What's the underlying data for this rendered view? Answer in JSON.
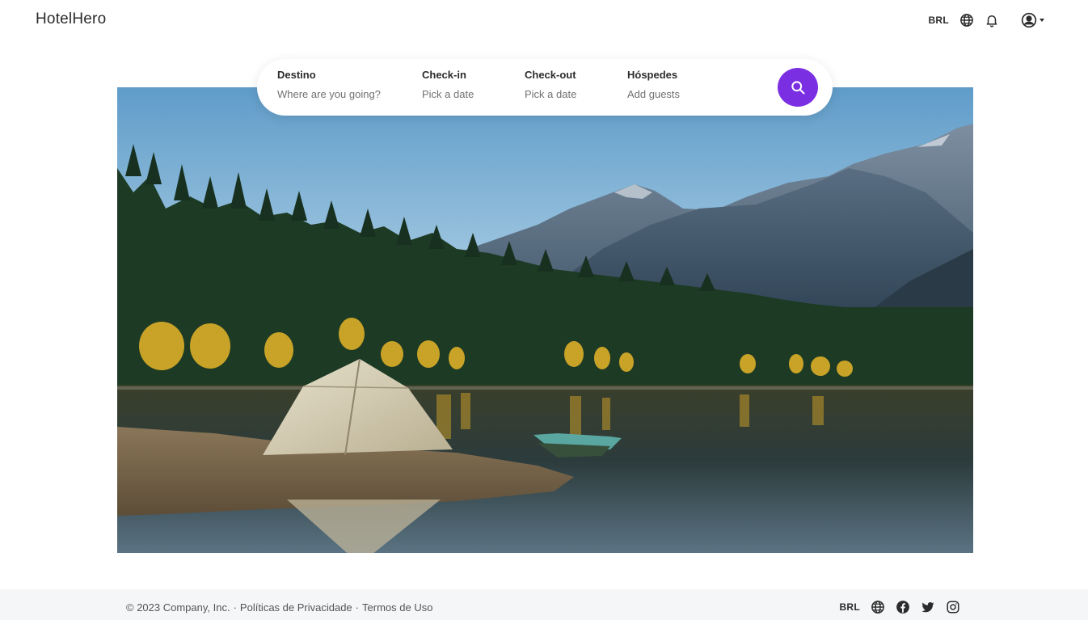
{
  "header": {
    "brand": "HotelHero",
    "currency": "BRL"
  },
  "icons": {
    "language": "globe-icon",
    "notifications": "bell-icon",
    "user": "user-circle-icon",
    "search": "search-icon"
  },
  "search": {
    "destination": {
      "label": "Destino",
      "placeholder": "Where are you going?"
    },
    "checkin": {
      "label": "Check-in",
      "placeholder": "Pick a date"
    },
    "checkout": {
      "label": "Check-out",
      "placeholder": "Pick a date"
    },
    "guests": {
      "label": "Hóspedes",
      "placeholder": "Add guests"
    }
  },
  "footer": {
    "copyright": "© 2023 Company, Inc.",
    "separator": "·",
    "privacy": "Políticas de Privacidade",
    "terms": "Termos de Uso",
    "currency": "BRL"
  },
  "colors": {
    "accent": "#7b2fe3",
    "footer_bg": "#f5f6f8",
    "text_dark": "#2b2b2b",
    "text_muted": "#717171"
  }
}
